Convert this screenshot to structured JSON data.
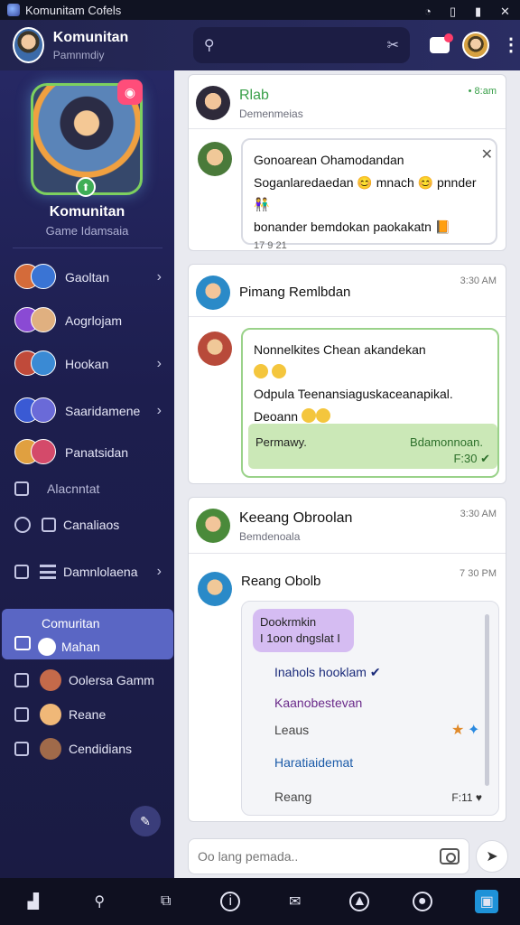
{
  "statusbar": {
    "app_title": "Komunitam Cofels"
  },
  "header": {
    "title": "Komunitan",
    "subtitle": "Pamnmdiy",
    "search_placeholder": ""
  },
  "sidebar": {
    "profile_name": "Komunitan",
    "profile_sub": "Game Idamsaia",
    "items": [
      {
        "label": "Gaoltan",
        "has_chevron": true
      },
      {
        "label": "Aogrlojam",
        "has_chevron": false
      },
      {
        "label": "Hookan",
        "has_chevron": true
      },
      {
        "label": "Saaridamene",
        "has_chevron": true
      },
      {
        "label": "Panatsidan",
        "has_chevron": false
      },
      {
        "label": "Alacnntat",
        "has_chevron": false
      },
      {
        "label": "Canaliaos",
        "has_chevron": false
      },
      {
        "label": "Damnlolaena",
        "has_chevron": true
      }
    ],
    "active": {
      "title": "Comuritan",
      "label": "Mahan"
    },
    "after": [
      {
        "label": "Oolersa Gamm"
      },
      {
        "label": "Reane"
      },
      {
        "label": "Cendidians"
      }
    ]
  },
  "feed": {
    "card1": {
      "name": "Rlab",
      "sub": "Demenmeias",
      "time": "• 8:am",
      "bubble_line1": "Gonoarean Ohamodandan",
      "bubble_line2": "Soganlaredaedan 😊 mnach 😊 pnnder 👫",
      "bubble_line3": "bonander bemdokan paokakatn 📙",
      "footer": "17 9 21"
    },
    "card2": {
      "name": "Pimang Remlbdan",
      "time": "3:30 AM",
      "bubble_line1": "Nonnelkites Chean akandekan",
      "bubble_line3": "Odpula Teenansiaguskaceanapikal.",
      "bubble_line4": "Deoann",
      "reply_left": "Permawy.",
      "reply_right": "Bdamonnoan.",
      "reply_status": "F:30 ✔"
    },
    "card3": {
      "name": "Keeang Obroolan",
      "sub": "Bemdenoala",
      "time": "3:30 AM",
      "msg_name": "Reang Obolb",
      "msg_time": "7 30 PM",
      "poll_tag_l1": "Dookrmkin",
      "poll_tag_l2": "I 1oon dngslat I",
      "options": [
        "Inahols hooklam ✔",
        "Kaanobestevan",
        "Leaus",
        "Haratiaidemat",
        "Reang"
      ],
      "poll_time": "F:11 ♥"
    }
  },
  "composer": {
    "placeholder": "Oo lang pemada.."
  },
  "colors": {
    "sidebar": "#1d1e4e",
    "topbar": "#2a2d63",
    "active_nav": "#5a66c4",
    "reply_bg": "#cbe8b7"
  }
}
